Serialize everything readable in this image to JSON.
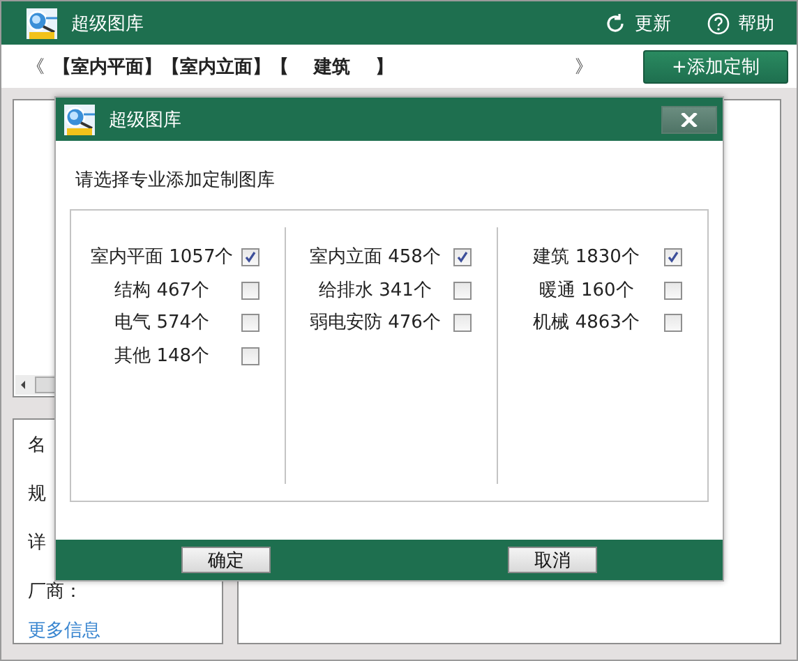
{
  "window": {
    "title": "超级图库",
    "toolbar_buttons": [
      {
        "kind": "refresh",
        "label": "更新"
      },
      {
        "kind": "help",
        "label": "帮助"
      }
    ]
  },
  "breadcrumb": {
    "prev": "《",
    "items": [
      "【室内平面】",
      "【室内立面】",
      "【    建筑    】"
    ],
    "next": "》"
  },
  "add_button": "+添加定制",
  "details_panel": {
    "fields": [
      "名",
      "规",
      "详",
      "厂商："
    ],
    "link": "更多信息"
  },
  "dialog": {
    "title": "超级图库",
    "prompt": "请选择专业添加定制图库",
    "columns": [
      [
        {
          "label": "室内平面 1057个",
          "checked": true
        },
        {
          "label": "结构 467个",
          "checked": false
        },
        {
          "label": "电气 574个",
          "checked": false
        },
        {
          "label": "其他 148个",
          "checked": false
        }
      ],
      [
        {
          "label": "室内立面 458个",
          "checked": true
        },
        {
          "label": "给排水 341个",
          "checked": false
        },
        {
          "label": "弱电安防 476个",
          "checked": false
        }
      ],
      [
        {
          "label": "建筑 1830个",
          "checked": true
        },
        {
          "label": "暖通 160个",
          "checked": false
        },
        {
          "label": "机械 4863个",
          "checked": false
        }
      ]
    ],
    "buttons": [
      "确定",
      "取消"
    ]
  }
}
